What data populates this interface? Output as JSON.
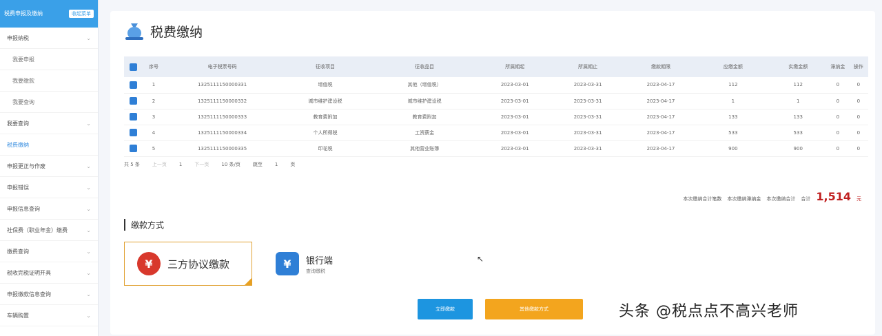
{
  "sidebar": {
    "top_label": "税费申报及缴纳",
    "fold_label": "收起菜单",
    "items": [
      {
        "label": "申报纳税",
        "sub": false,
        "chevron": true
      },
      {
        "label": "我要申报",
        "sub": true,
        "chevron": false
      },
      {
        "label": "我要缴款",
        "sub": true,
        "chevron": false
      },
      {
        "label": "我要查询",
        "sub": true,
        "chevron": false
      },
      {
        "label": "我要查询",
        "sub": false,
        "chevron": true
      },
      {
        "label": "税费缴纳",
        "sub": false,
        "chevron": false,
        "active": true
      },
      {
        "label": "申报更正与作废",
        "sub": false,
        "chevron": true
      },
      {
        "label": "申报错误",
        "sub": false,
        "chevron": true
      },
      {
        "label": "申报信息查询",
        "sub": false,
        "chevron": true
      },
      {
        "label": "社保费（职业年金）缴费",
        "sub": false,
        "chevron": true
      },
      {
        "label": "缴费查询",
        "sub": false,
        "chevron": true
      },
      {
        "label": "税收完税证明开具",
        "sub": false,
        "chevron": true
      },
      {
        "label": "申报缴款信息查询",
        "sub": false,
        "chevron": true
      },
      {
        "label": "车辆购置",
        "sub": false,
        "chevron": true
      }
    ]
  },
  "page": {
    "title": "税费缴纳"
  },
  "table": {
    "headers": [
      "序号",
      "电子税票号码",
      "征收项目",
      "征收品目",
      "所属期起",
      "所属期止",
      "缴款期限",
      "应缴金额",
      "实缴金额",
      "滞纳金",
      "操作"
    ],
    "rows": [
      {
        "no": "1",
        "ticket": "1325111150000331",
        "item": "增值税",
        "sub": "其他（增值税）",
        "start": "2023-03-01",
        "end": "2023-03-31",
        "deadline": "2023-04-17",
        "due": "112",
        "paid": "112",
        "late": "0",
        "op": "0"
      },
      {
        "no": "2",
        "ticket": "1325111150000332",
        "item": "城市维护建设税",
        "sub": "城市维护建设税",
        "start": "2023-03-01",
        "end": "2023-03-31",
        "deadline": "2023-04-17",
        "due": "1",
        "paid": "1",
        "late": "0",
        "op": "0"
      },
      {
        "no": "3",
        "ticket": "1325111150000333",
        "item": "教育费附加",
        "sub": "教育费附加",
        "start": "2023-03-01",
        "end": "2023-03-31",
        "deadline": "2023-04-17",
        "due": "133",
        "paid": "133",
        "late": "0",
        "op": "0"
      },
      {
        "no": "4",
        "ticket": "1325111150000334",
        "item": "个人所得税",
        "sub": "工资薪金",
        "start": "2023-03-01",
        "end": "2023-03-31",
        "deadline": "2023-04-17",
        "due": "533",
        "paid": "533",
        "late": "0",
        "op": "0"
      },
      {
        "no": "5",
        "ticket": "1325111150000335",
        "item": "印花税",
        "sub": "其他营业账簿",
        "start": "2023-03-01",
        "end": "2023-03-31",
        "deadline": "2023-04-17",
        "due": "900",
        "paid": "900",
        "late": "0",
        "op": "0"
      }
    ]
  },
  "pager": {
    "total": "共 5 条",
    "prev": "上一页",
    "page": "1",
    "next": "下一页",
    "size": "10 条/页",
    "goto": "跳至",
    "goto_page": "1",
    "page_unit": "页"
  },
  "summary": {
    "text1": "本次缴纳合计笔数",
    "text2": "本次缴纳滞纳金",
    "text3": "本次缴纳合计",
    "total_label": "合计",
    "total_amount": "1,514",
    "unit": "元"
  },
  "payment": {
    "section_label": "缴款方式",
    "three_party": "三方协议缴款",
    "bank": "银行端",
    "bank_sub": "查询缴税"
  },
  "buttons": {
    "confirm": "立即缴款",
    "other": "其他缴款方式"
  },
  "watermark": "头条 @税点点不高兴老师"
}
